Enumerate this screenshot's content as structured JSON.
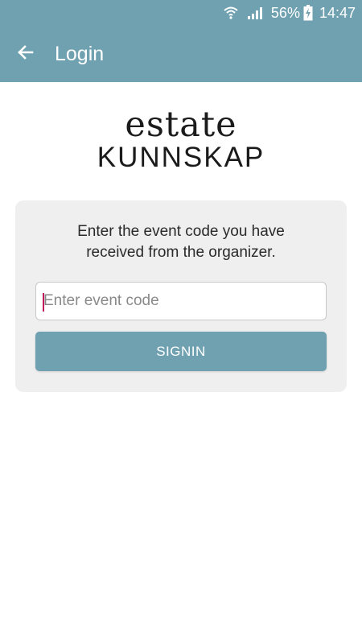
{
  "status_bar": {
    "battery_percent": "56%",
    "time": "14:47",
    "icons": [
      "wifi-icon",
      "signal-icon",
      "battery-charging-icon"
    ]
  },
  "app_bar": {
    "title": "Login",
    "back_icon": "arrow-left-icon"
  },
  "logo": {
    "line1": "estate",
    "line2": "KUNNSKAP"
  },
  "card": {
    "instruction_line1": "Enter the event code you have",
    "instruction_line2": "received from the organizer.",
    "code_input": {
      "value": "",
      "placeholder": "Enter event code"
    },
    "signin_label": "SIGNIN"
  },
  "colors": {
    "primary": "#6fa1b1",
    "card_background": "#efefef",
    "caret": "#c2185b"
  }
}
